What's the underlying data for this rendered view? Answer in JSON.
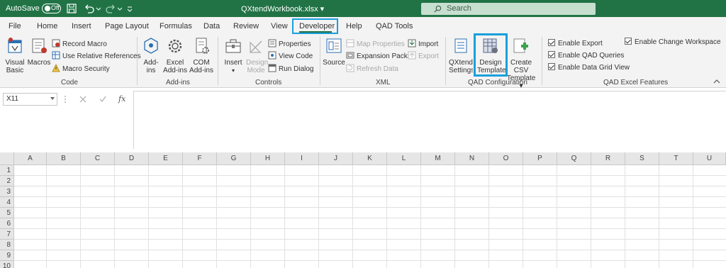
{
  "titlebar": {
    "autosave_label": "AutoSave",
    "autosave_state": "Off",
    "title": "QXtendWorkbook.xlsx",
    "search_placeholder": "Search",
    "bg_color": "#217346"
  },
  "tabs": [
    "File",
    "Home",
    "Insert",
    "Page Layout",
    "Formulas",
    "Data",
    "Review",
    "View",
    "Developer",
    "Help",
    "QAD Tools"
  ],
  "active_tab": "Developer",
  "ribbon": {
    "code": {
      "label": "Code",
      "visual_basic": "Visual Basic",
      "macros": "Macros",
      "record_macro": "Record Macro",
      "use_relative": "Use Relative References",
      "macro_security": "Macro Security"
    },
    "addins": {
      "label": "Add-ins",
      "addins": "Add-ins",
      "excel_addins": "Excel Add-ins",
      "com_addins": "COM Add-ins"
    },
    "controls": {
      "label": "Controls",
      "insert": "Insert",
      "design_mode": "Design Mode",
      "properties": "Properties",
      "view_code": "View Code",
      "run_dialog": "Run Dialog"
    },
    "xml": {
      "label": "XML",
      "source": "Source",
      "map_properties": "Map Properties",
      "expansion_packs": "Expansion Packs",
      "refresh_data": "Refresh Data",
      "import": "Import",
      "export": "Export"
    },
    "qad_config": {
      "label": "QAD Configuration",
      "qxtend_settings": "QXtend Settings",
      "design_template": "Design Template",
      "create_csv": "Create CSV Template"
    },
    "qad_features": {
      "label": "QAD Excel Features",
      "enable_export": "Enable Export",
      "enable_qad_queries": "Enable QAD Queries",
      "enable_data_grid": "Enable Data Grid View",
      "enable_change_ws": "Enable Change Workspace"
    }
  },
  "formula_bar": {
    "name_box": "X11",
    "fx": "fx",
    "formula": ""
  },
  "grid": {
    "columns": [
      "A",
      "B",
      "C",
      "D",
      "E",
      "F",
      "G",
      "H",
      "I",
      "J",
      "K",
      "L",
      "M",
      "N",
      "O",
      "P",
      "Q",
      "R",
      "S",
      "T",
      "U"
    ],
    "rows": [
      "1",
      "2",
      "3",
      "4",
      "5",
      "6",
      "7",
      "8",
      "9",
      "10"
    ]
  }
}
